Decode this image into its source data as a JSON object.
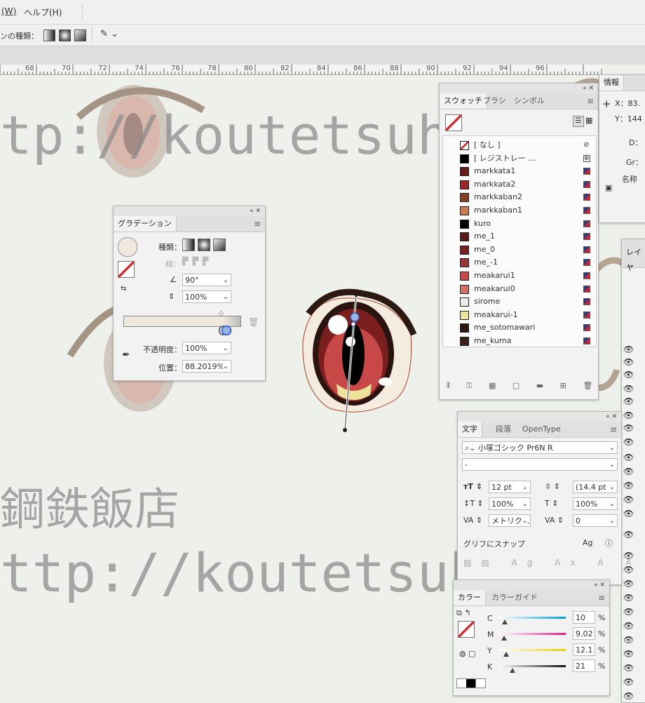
{
  "menubar": {
    "items": [
      "(W)",
      "ヘルプ(H)"
    ]
  },
  "control": {
    "gradient_type_label": "ンの種類："
  },
  "ruler": {
    "ticks": [
      "68",
      "70",
      "72",
      "74",
      "76",
      "78",
      "80",
      "82",
      "84",
      "86",
      "88",
      "90",
      "92",
      "94",
      "96"
    ]
  },
  "watermark": {
    "url": "tp://koutetsuha",
    "url2": "ttp://koutetsuha",
    "shop": "鋼鉄飯店"
  },
  "gradient_panel": {
    "tab": "グラデーション",
    "type_label": "種類：",
    "stroke_label": "線：",
    "angle": "90°",
    "aspect": "100%",
    "opacity_label": "不透明度：",
    "opacity": "100%",
    "position_label": "位置：",
    "position": "88.2019%"
  },
  "swatches_panel": {
    "tabs": [
      "スウォッチ",
      "ブラシ",
      "シンボル"
    ],
    "items": [
      {
        "name": "[ なし ]",
        "color": "none"
      },
      {
        "name": "[ レジストレー ...",
        "color": "#000000"
      },
      {
        "name": "markkata1",
        "color": "#6b1a18"
      },
      {
        "name": "markkata2",
        "color": "#a02626"
      },
      {
        "name": "markkaban2",
        "color": "#8a3e22"
      },
      {
        "name": "markkaban1",
        "color": "#cc7a4e"
      },
      {
        "name": "kuro",
        "color": "#000000"
      },
      {
        "name": "me_1",
        "color": "#5b1a14"
      },
      {
        "name": "me_0",
        "color": "#7a1e1e"
      },
      {
        "name": "me_-1",
        "color": "#9c3434"
      },
      {
        "name": "meakarui1",
        "color": "#c84848"
      },
      {
        "name": "meakarui0",
        "color": "#d87068"
      },
      {
        "name": "sirome",
        "color": "#eeeae4"
      },
      {
        "name": "meakarui-1",
        "color": "#ece49c"
      },
      {
        "name": "me_sotomawari",
        "color": "#2e1610"
      },
      {
        "name": "me_kuma",
        "color": "#3a2018"
      }
    ]
  },
  "info_panel": {
    "tab": "情報",
    "x": "X：83.",
    "y": "Y：144",
    "d": "D：",
    "gr": "Gr：",
    "name": "名称"
  },
  "layers_panel": {
    "tab": "レイヤ"
  },
  "character_panel": {
    "tabs": [
      "文字",
      "段落",
      "OpenType"
    ],
    "font": "小塚ゴシック Pr6N R",
    "style": "-",
    "size": "12 pt",
    "leading": "(14.4 pt",
    "vscale": "100%",
    "hscale": "100%",
    "kerning": "メトリクス",
    "tracking": "0",
    "snap_label": "グリフにスナップ"
  },
  "color_panel": {
    "tabs": [
      "カラー",
      "カラーガイド"
    ],
    "c": "10",
    "m": "9.02",
    "y": "12.1",
    "k": "21",
    "pct": "%",
    "c_label": "C",
    "m_label": "M",
    "y_label": "Y",
    "k_label": "K"
  }
}
